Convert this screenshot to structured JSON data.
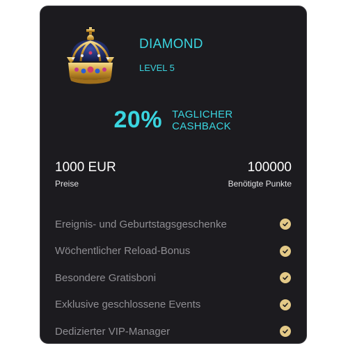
{
  "tier": {
    "name": "DIAMOND",
    "level": "LEVEL 5"
  },
  "cashback": {
    "percent": "20%",
    "line1": "TAGLICHER",
    "line2": "CASHBACK"
  },
  "stats": {
    "prize_value": "1000 EUR",
    "prize_label": "Preise",
    "points_value": "100000",
    "points_label": "Benötigte Punkte"
  },
  "features": [
    "Ereignis- und Geburtstagsgeschenke",
    "Wöchentlicher Reload-Bonus",
    "Besondere Gratisboni",
    "Exklusive geschlossene Events",
    "Dedizierter VIP-Manager"
  ],
  "colors": {
    "card_background": "#1c1b1f",
    "accent": "#3ad5e0",
    "check_badge": "#e3c987",
    "muted_text": "#8f8e93"
  },
  "icons": {
    "tier": "crown-icon",
    "feature_status": "check-circle-icon"
  }
}
